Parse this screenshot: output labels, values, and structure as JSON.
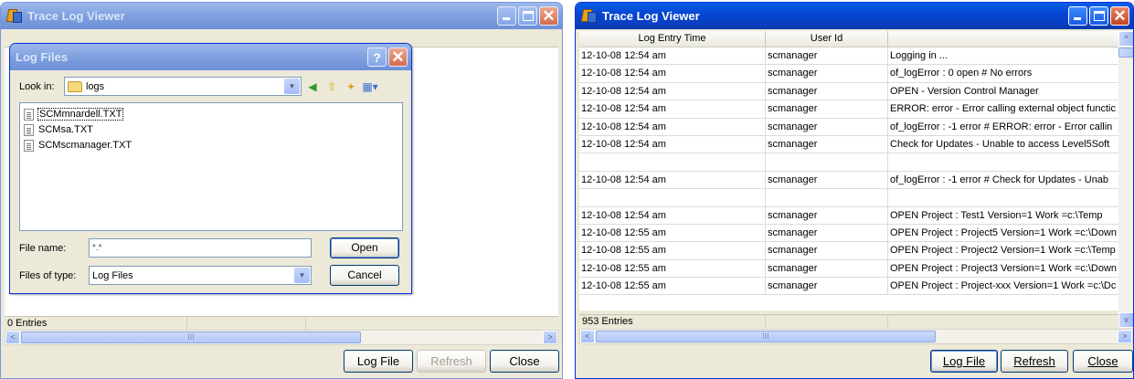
{
  "left_window": {
    "title": "Trace Log Viewer",
    "status": "0 Entries",
    "buttons": {
      "log_file": "Log File",
      "refresh": "Refresh",
      "close": "Close"
    },
    "scroll_grip": "III"
  },
  "dialog": {
    "title": "Log Files",
    "help": "?",
    "look_in_label": "Look in:",
    "look_in_value": "logs",
    "files": [
      "SCMmnardell.TXT",
      "SCMsa.TXT",
      "SCMscmanager.TXT"
    ],
    "file_name_label": "File name:",
    "file_name_value": "*.*",
    "files_of_type_label": "Files of type:",
    "files_of_type_value": "Log Files",
    "open_button": "Open",
    "cancel_button": "Cancel"
  },
  "right_window": {
    "title": "Trace Log Viewer",
    "columns": [
      "Log Entry Time",
      "User Id",
      ""
    ],
    "rows": [
      [
        "12-10-08 12:54 am",
        "scmanager",
        "Logging in ..."
      ],
      [
        "12-10-08 12:54 am",
        "scmanager",
        "of_logError : 0  open # No errors"
      ],
      [
        "12-10-08 12:54 am",
        "scmanager",
        "OPEN - Version Control Manager"
      ],
      [
        "12-10-08 12:54 am",
        "scmanager",
        "ERROR: error - Error calling external object functic"
      ],
      [
        "12-10-08 12:54 am",
        "scmanager",
        "of_logError : -1  error # ERROR: error - Error callin"
      ],
      [
        "12-10-08 12:54 am",
        "scmanager",
        "Check for Updates - Unable to access Level5Soft"
      ],
      [
        "",
        "",
        ""
      ],
      [
        "12-10-08 12:54 am",
        "scmanager",
        "of_logError : -1  error # Check for Updates - Unab"
      ],
      [
        "",
        "",
        ""
      ],
      [
        "12-10-08 12:54 am",
        "scmanager",
        "OPEN Project : Test1 Version=1 Work =c:\\Temp"
      ],
      [
        "12-10-08 12:55 am",
        "scmanager",
        "OPEN Project : Project5 Version=1 Work =c:\\Down"
      ],
      [
        "12-10-08 12:55 am",
        "scmanager",
        "OPEN Project : Project2 Version=1 Work =c:\\Temp"
      ],
      [
        "12-10-08 12:55 am",
        "scmanager",
        "OPEN Project : Project3 Version=1 Work =c:\\Down"
      ],
      [
        "12-10-08 12:55 am",
        "scmanager",
        "OPEN Project : Project-xxx Version=1 Work =c:\\Dc"
      ]
    ],
    "status": "953 Entries",
    "buttons": {
      "log_file": "Log File",
      "refresh": "Refresh",
      "close": "Close"
    },
    "scroll_grip": "III"
  }
}
